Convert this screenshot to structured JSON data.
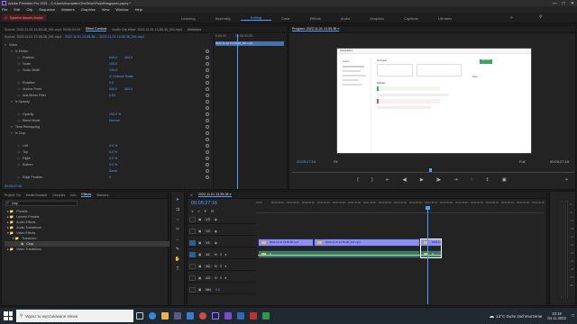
{
  "app": {
    "title": "Adobe Premiere Pro 2021 - C:\\Users\\borowiec\\OneDrive\\Pulpit\\Nagrywki.prproj *"
  },
  "menu": [
    "File",
    "Edit",
    "Clip",
    "Sequence",
    "Markers",
    "Graphics",
    "View",
    "Window",
    "Help"
  ],
  "alert": "System issues found",
  "workspaces": [
    "Learning",
    "Assembly",
    "Editing",
    "Color",
    "Effects",
    "Audio",
    "Graphics",
    "Captions",
    "Libraries"
  ],
  "active_workspace": "Editing",
  "source_tabs": [
    "Source: 2022-11-01 13-55-38_001.mp4: 00:00:24:19",
    "Effect Controls",
    "Audio Clip Mixer: 2022-11-01 13-55-38_001.mp4",
    "Metadata"
  ],
  "ec": {
    "master": "Source: 2022-11-01 13-55-38_001.mp4",
    "seq": "2022-11-01 13-55-38 ... 2022-11-01 13-56-38_001.mp4",
    "time_a": "0;00:00",
    "time_b": "00:05:00:00",
    "clip_label": "2022-11-01 13-55-38_001.mp4",
    "rows": [
      {
        "label": "Video",
        "indent": 0
      },
      {
        "label": "fx Motion",
        "indent": 1
      },
      {
        "label": "Position",
        "indent": 2,
        "v": "640.0",
        "v2": "360.0"
      },
      {
        "label": "Scale",
        "indent": 2,
        "v": "100.0"
      },
      {
        "label": "Scale Width",
        "indent": 2,
        "v": "100.0"
      },
      {
        "label": "",
        "indent": 2,
        "v": "☑ Uniform Scale"
      },
      {
        "label": "Rotation",
        "indent": 2,
        "v": "0.0"
      },
      {
        "label": "Anchor Point",
        "indent": 2,
        "v": "640.0",
        "v2": "360.0"
      },
      {
        "label": "Anti-flicker Filter",
        "indent": 2,
        "v": "0.00"
      },
      {
        "label": "fx Opacity",
        "indent": 1
      },
      {
        "label": "",
        "indent": 2,
        "v": ""
      },
      {
        "label": "Opacity",
        "indent": 2,
        "v": "100.0 %"
      },
      {
        "label": "Blend Mode",
        "indent": 2,
        "v": "Normal"
      },
      {
        "label": "Time Remapping",
        "indent": 1
      },
      {
        "label": "fx Crop",
        "indent": 1
      },
      {
        "label": "",
        "indent": 2,
        "v": ""
      },
      {
        "label": "Left",
        "indent": 2,
        "v": "0.0 %"
      },
      {
        "label": "Top",
        "indent": 2,
        "v": "0.0 %"
      },
      {
        "label": "Right",
        "indent": 2,
        "v": "0.0 %"
      },
      {
        "label": "Bottom",
        "indent": 2,
        "v": "0.0 %"
      },
      {
        "label": "",
        "indent": 2,
        "v": "Zoom"
      },
      {
        "label": "Edge Feather",
        "indent": 2,
        "v": "0"
      }
    ],
    "timecode": "00:05:27:16"
  },
  "program": {
    "title": "Program: 2022-11-01 13-55-38 ≡",
    "timecode": "00:05:27:16",
    "zoom": "Fit",
    "scale": "Full",
    "duration": "00:05:27:19",
    "screen": {
      "app_title": "Subscription",
      "search": "Search",
      "label1": "Overview",
      "section": "Settings",
      "btn": "Add new",
      "col": "Name"
    }
  },
  "project_tabs": [
    "Project: Sp",
    "Media Browser",
    "Libraries",
    "Info",
    "Effects",
    "Markers"
  ],
  "effects_search": "crop",
  "effects_tree": [
    "Presets",
    "Lumetri Presets",
    "Audio Effects",
    "Audio Transitions",
    "Video Effects",
    "Transform",
    "Crop",
    "Video Transitions"
  ],
  "timeline": {
    "tab": "2022-11-01 13-55-38 ≡",
    "timecode": "00:05:27:16",
    "ruler": [
      "00:00",
      "00:00:15:00",
      "00:00:30:00",
      "00:00:45:00",
      "00:01:00:00",
      "00:01:15:00",
      "00:01:30:00",
      "00:01:45:00",
      "00:02:00:00",
      "00:02:15:00",
      "00:02:30:00",
      "00:02:45:00",
      "00:03:00:00",
      "00:03:15:00",
      "00:03:30:00",
      "00:03:45:00",
      "00:04:00:00",
      "00:04:15:00",
      "00:04:30:00"
    ],
    "tracks": [
      "V3",
      "V2",
      "V1",
      "A1",
      "A2",
      "A3",
      "Mix"
    ],
    "clips": [
      "2022-11-01 13-55-38.mp4",
      "2022-11-01 13-55-38_001.mp4",
      "2022-11-01 13-55-38",
      "fx",
      "fx"
    ],
    "mix_value": "0.0"
  },
  "taskbar": {
    "search": "Wpisz tu wyszukiwane słowa",
    "weather": "13°C  Duże zachmurzenie",
    "time": "22:18",
    "date": "04.11.2022"
  }
}
